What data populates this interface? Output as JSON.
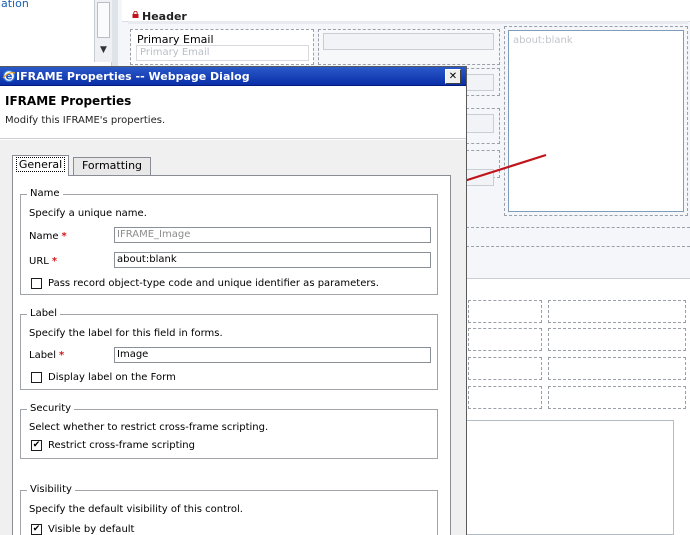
{
  "background": {
    "left_panel_link": "ation",
    "header_label": "Header",
    "primary_email": {
      "label": "Primary Email",
      "placeholder": "Primary Email"
    },
    "iframe_preview_text": "about:blank"
  },
  "dialog": {
    "window_title": "IFRAME Properties -- Webpage Dialog",
    "close_glyph": "✕",
    "heading": "IFRAME Properties",
    "subheading": "Modify this IFRAME's properties.",
    "tabs": [
      {
        "label": "General",
        "selected": true
      },
      {
        "label": "Formatting",
        "selected": false
      }
    ],
    "name_section": {
      "legend": "Name",
      "description": "Specify a unique name.",
      "name_label": "Name",
      "name_value": "IFRAME_Image",
      "url_label": "URL",
      "url_value": "about:blank",
      "pass_params_label": "Pass record object-type code and unique identifier as parameters.",
      "pass_params_checked": false
    },
    "label_section": {
      "legend": "Label",
      "description": "Specify the label for this field in forms.",
      "label_label": "Label",
      "label_value": "Image",
      "display_label_text": "Display label on the Form",
      "display_label_checked": false
    },
    "security_section": {
      "legend": "Security",
      "description": "Select whether to restrict cross-frame scripting.",
      "restrict_label": "Restrict cross-frame scripting",
      "restrict_checked": true
    },
    "visibility_section": {
      "legend": "Visibility",
      "description": "Specify the default visibility of this control.",
      "visible_label": "Visible by default",
      "visible_checked": true
    },
    "required_marker": "*",
    "check_glyph": "✔"
  },
  "colors": {
    "titlebar": "#0a2fa8",
    "required_star": "#d21a1a",
    "annotation_arrow": "#c0141b"
  }
}
